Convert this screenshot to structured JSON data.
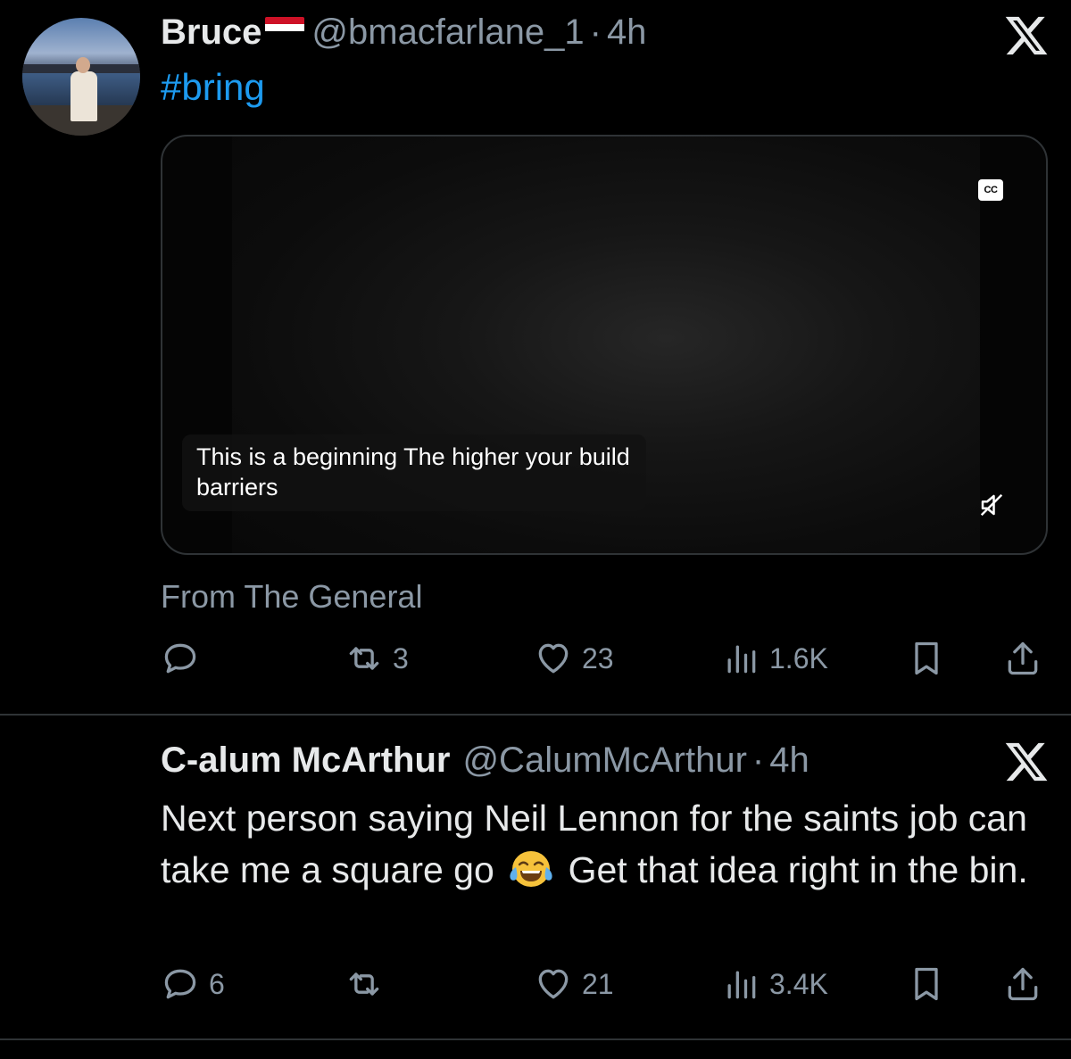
{
  "tweets": [
    {
      "name": "Bruce",
      "handle": "@bmacfarlane_1",
      "time_sep": "·",
      "time": "4h",
      "text": "#bring",
      "media": {
        "cc_label": "CC",
        "caption": "This is a beginning The higher your build barriers"
      },
      "source": "From The General",
      "stats": {
        "replies": "",
        "retweets": "3",
        "likes": "23",
        "views": "1.6K"
      }
    },
    {
      "name": "C-alum McArthur",
      "handle": "@CalumMcArthur",
      "time_sep": "·",
      "time": "4h",
      "text_before_emoji": "Next person saying Neil Lennon for the saints job can take me a square go",
      "text_after_emoji": "Get that idea right in the bin.",
      "emoji_name": "face-with-tears-of-joy-emoji",
      "stats": {
        "replies": "6",
        "retweets": "",
        "likes": "21",
        "views": "3.4K"
      }
    }
  ],
  "colors": {
    "background": "#000000",
    "text": "#e7e9ea",
    "secondary": "#8b98a5",
    "link": "#1d9bf0",
    "divider": "#2f3336"
  },
  "icons": [
    "x-logo-icon",
    "reply-icon",
    "retweet-icon",
    "like-icon",
    "views-icon",
    "bookmark-icon",
    "share-icon",
    "closed-captions-icon",
    "mute-icon"
  ]
}
